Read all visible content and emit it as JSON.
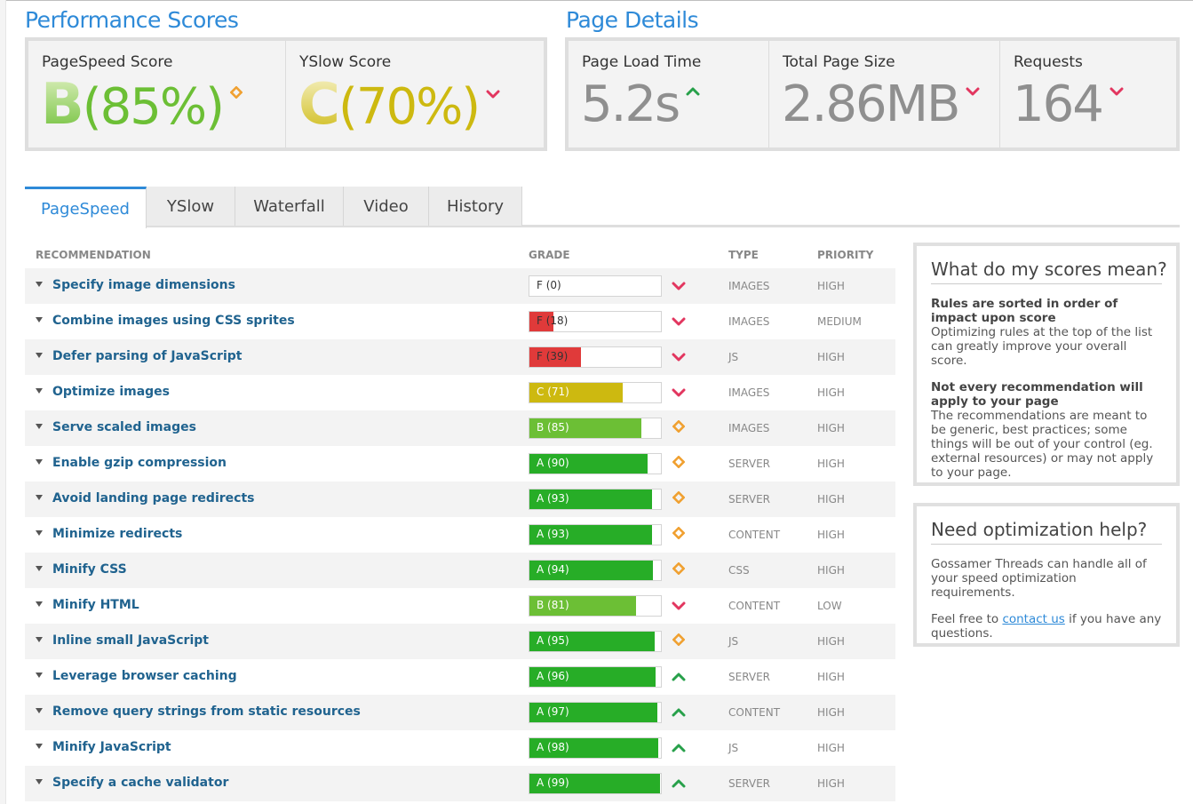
{
  "performance": {
    "title": "Performance Scores",
    "pagespeed": {
      "label": "PageSpeed Score",
      "letter": "B",
      "percent": "(85%)",
      "trend": "◆"
    },
    "yslow": {
      "label": "YSlow Score",
      "letter": "C",
      "percent": "(70%)",
      "trend": "❤"
    }
  },
  "details": {
    "title": "Page Details",
    "load_time": {
      "label": "Page Load Time",
      "value": "5.2s",
      "trend": "⌃"
    },
    "page_size": {
      "label": "Total Page Size",
      "value": "2.86MB",
      "trend": "❤"
    },
    "requests": {
      "label": "Requests",
      "value": "164",
      "trend": "❤"
    }
  },
  "colors": {
    "accent": "#2e8ad8",
    "grade_a": "#27ad27",
    "grade_b": "#6cbf35",
    "grade_c": "#cdb910",
    "grade_f": "#e03a3a",
    "trend_down": "#e2365f",
    "trend_neutral": "#f0a030",
    "trend_up": "#27a04a"
  },
  "tabs": [
    {
      "label": "PageSpeed",
      "active": true
    },
    {
      "label": "YSlow",
      "active": false
    },
    {
      "label": "Waterfall",
      "active": false
    },
    {
      "label": "Video",
      "active": false
    },
    {
      "label": "History",
      "active": false
    }
  ],
  "table": {
    "headers": {
      "recommendation": "RECOMMENDATION",
      "grade": "GRADE",
      "type": "TYPE",
      "priority": "PRIORITY"
    },
    "rows": [
      {
        "name": "Specify image dimensions",
        "grade": "F (0)",
        "score": 0,
        "trend": "down",
        "type": "IMAGES",
        "priority": "HIGH"
      },
      {
        "name": "Combine images using CSS sprites",
        "grade": "F (18)",
        "score": 18,
        "trend": "down",
        "type": "IMAGES",
        "priority": "MEDIUM"
      },
      {
        "name": "Defer parsing of JavaScript",
        "grade": "F (39)",
        "score": 39,
        "trend": "down",
        "type": "JS",
        "priority": "HIGH"
      },
      {
        "name": "Optimize images",
        "grade": "C (71)",
        "score": 71,
        "trend": "down",
        "type": "IMAGES",
        "priority": "HIGH"
      },
      {
        "name": "Serve scaled images",
        "grade": "B (85)",
        "score": 85,
        "trend": "neutral",
        "type": "IMAGES",
        "priority": "HIGH"
      },
      {
        "name": "Enable gzip compression",
        "grade": "A (90)",
        "score": 90,
        "trend": "neutral",
        "type": "SERVER",
        "priority": "HIGH"
      },
      {
        "name": "Avoid landing page redirects",
        "grade": "A (93)",
        "score": 93,
        "trend": "neutral",
        "type": "SERVER",
        "priority": "HIGH"
      },
      {
        "name": "Minimize redirects",
        "grade": "A (93)",
        "score": 93,
        "trend": "neutral",
        "type": "CONTENT",
        "priority": "HIGH"
      },
      {
        "name": "Minify CSS",
        "grade": "A (94)",
        "score": 94,
        "trend": "neutral",
        "type": "CSS",
        "priority": "HIGH"
      },
      {
        "name": "Minify HTML",
        "grade": "B (81)",
        "score": 81,
        "trend": "down",
        "type": "CONTENT",
        "priority": "LOW"
      },
      {
        "name": "Inline small JavaScript",
        "grade": "A (95)",
        "score": 95,
        "trend": "neutral",
        "type": "JS",
        "priority": "HIGH"
      },
      {
        "name": "Leverage browser caching",
        "grade": "A (96)",
        "score": 96,
        "trend": "up",
        "type": "SERVER",
        "priority": "HIGH"
      },
      {
        "name": "Remove query strings from static resources",
        "grade": "A (97)",
        "score": 97,
        "trend": "up",
        "type": "CONTENT",
        "priority": "HIGH"
      },
      {
        "name": "Minify JavaScript",
        "grade": "A (98)",
        "score": 98,
        "trend": "up",
        "type": "JS",
        "priority": "HIGH"
      },
      {
        "name": "Specify a cache validator",
        "grade": "A (99)",
        "score": 99,
        "trend": "up",
        "type": "SERVER",
        "priority": "HIGH"
      }
    ]
  },
  "sidebar": {
    "scores": {
      "title": "What do my scores mean?",
      "p1_bold": "Rules are sorted in order of impact upon score",
      "p1_text": "Optimizing rules at the top of the list can greatly improve your overall score.",
      "p2_bold": "Not every recommendation will apply to your page",
      "p2_text": "The recommendations are meant to be generic, best practices; some things will be out of your control (eg. external resources) or may not apply to your page."
    },
    "help": {
      "title": "Need optimization help?",
      "p1": "Gossamer Threads can handle all of your speed optimization requirements.",
      "p2_before": "Feel free to ",
      "p2_link": "contact us",
      "p2_after": " if you have any questions."
    }
  }
}
